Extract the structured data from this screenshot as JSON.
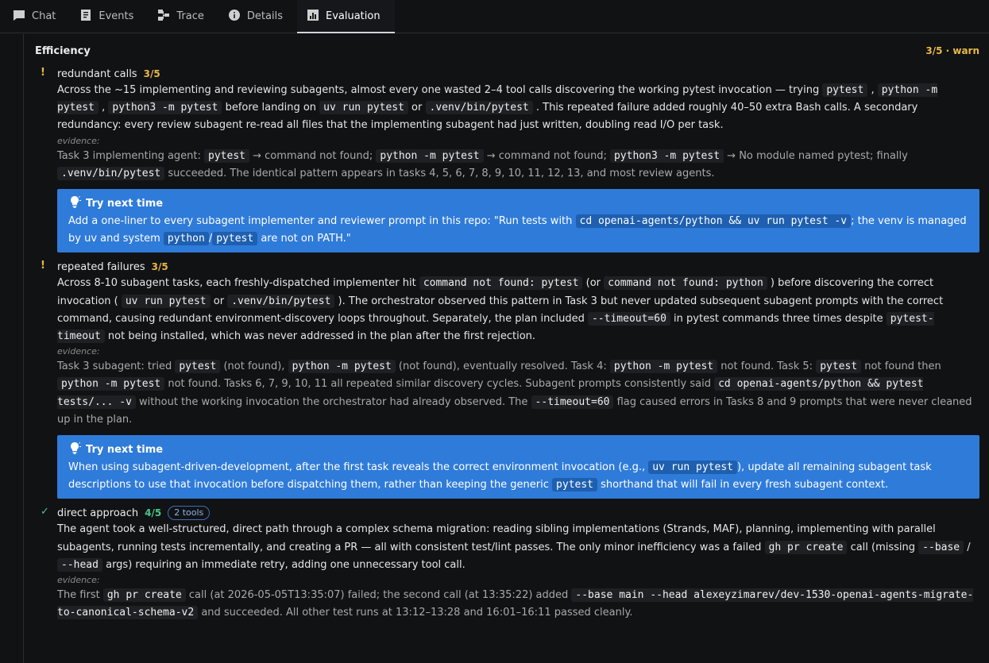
{
  "tabs": [
    {
      "label": "Chat",
      "icon": "chat-icon"
    },
    {
      "label": "Events",
      "icon": "events-icon"
    },
    {
      "label": "Trace",
      "icon": "trace-icon"
    },
    {
      "label": "Details",
      "icon": "info-icon"
    },
    {
      "label": "Evaluation",
      "icon": "chart-icon",
      "active": true
    }
  ],
  "section": {
    "title": "Efficiency",
    "score": "3/5 · warn"
  },
  "evidence_label": "evidence:",
  "tip_title": "Try next time",
  "items": [
    {
      "marker": "!",
      "name": "redundant calls",
      "score": "3/5",
      "desc": [
        "Across the ~15 implementing and reviewing subagents, almost every one wasted 2–4 tool calls discovering the working pytest invocation — trying ",
        "pytest",
        " , ",
        "python -m pytest",
        " , ",
        "python3 -m pytest",
        " before landing on ",
        "uv run pytest",
        " or ",
        ".venv/bin/pytest",
        " . This repeated failure added roughly 40–50 extra Bash calls. A secondary redundancy: every review subagent re-read all files that the implementing subagent had just written, doubling read I/O per task."
      ],
      "evidence": [
        "Task 3 implementing agent: ",
        "pytest",
        " → command not found; ",
        "python -m pytest",
        " → command not found; ",
        "python3 -m pytest",
        " → No module named pytest; finally ",
        ".venv/bin/pytest",
        " succeeded. The identical pattern appears in tasks 4, 5, 6, 7, 8, 9, 10, 11, 12, 13, and most review agents."
      ],
      "tip": [
        "Add a one-liner to every subagent implementer and reviewer prompt in this repo: \"Run tests with ",
        "cd openai-agents/python && uv run pytest -v",
        "; the venv is managed by uv and system ",
        "python",
        "/",
        "pytest",
        " are not on PATH.\""
      ]
    },
    {
      "marker": "!",
      "name": "repeated failures",
      "score": "3/5",
      "desc": [
        "Across 8-10 subagent tasks, each freshly-dispatched implementer hit ",
        "command not found: pytest",
        " (or ",
        "command not found: python",
        " ) before discovering the correct invocation ( ",
        "uv run pytest",
        " or ",
        ".venv/bin/pytest",
        " ). The orchestrator observed this pattern in Task 3 but never updated subsequent subagent prompts with the correct command, causing redundant environment-discovery loops throughout. Separately, the plan included ",
        "--timeout=60",
        " in pytest commands three times despite ",
        "pytest-timeout",
        " not being installed, which was never addressed in the plan after the first rejection."
      ],
      "evidence": [
        "Task 3 subagent: tried ",
        "pytest",
        " (not found), ",
        "python -m pytest",
        " (not found), eventually resolved. Task 4: ",
        "python -m pytest",
        " not found. Task 5: ",
        "pytest",
        " not found then ",
        "python -m pytest",
        " not found. Tasks 6, 7, 9, 10, 11 all repeated similar discovery cycles. Subagent prompts consistently said ",
        "cd openai-agents/python && pytest tests/... -v",
        " without the working invocation the orchestrator had already observed. The ",
        "--timeout=60",
        " flag caused errors in Tasks 8 and 9 prompts that were never cleaned up in the plan."
      ],
      "tip": [
        "When using subagent-driven-development, after the first task reveals the correct environment invocation (e.g., ",
        "uv run pytest",
        "), update all remaining subagent task descriptions to use that invocation before dispatching them, rather than keeping the generic ",
        "pytest",
        " shorthand that will fail in every fresh subagent context."
      ]
    },
    {
      "marker": "✓",
      "name": "direct approach",
      "score": "4/5",
      "badge": "2 tools",
      "desc": [
        "The agent took a well-structured, direct path through a complex schema migration: reading sibling implementations (Strands, MAF), planning, implementing with parallel subagents, running tests incrementally, and creating a PR — all with consistent test/lint passes. The only minor inefficiency was a failed ",
        "gh pr create",
        " call (missing ",
        "--base",
        " / ",
        "--head",
        " args) requiring an immediate retry, adding one unnecessary tool call."
      ],
      "evidence": [
        "The first ",
        "gh pr create",
        " call (at 2026-05-05T13:35:07) failed; the second call (at 13:35:22) added ",
        "--base main --head alexeyzimarev/dev-1530-openai-agents-migrate-to-canonical-schema-v2",
        " and succeeded. All other test runs at 13:12–13:28 and 16:01–16:11 passed cleanly."
      ]
    }
  ]
}
